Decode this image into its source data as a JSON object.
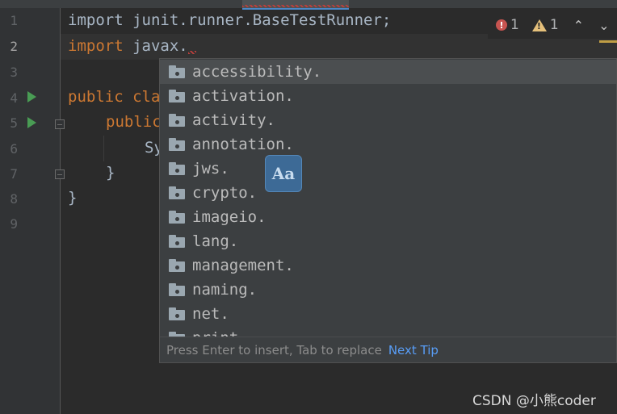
{
  "gutter": {
    "line_numbers": [
      "1",
      "2",
      "3",
      "4",
      "5",
      "6",
      "7",
      "8",
      "9"
    ]
  },
  "code": {
    "line1": "import junit.runner.BaseTestRunner;",
    "line2_kw": "import",
    "line2_rest": " javax.",
    "line4_kw": "public cla",
    "line5_kw": "public",
    "line6": "Sy",
    "line7": "}",
    "line8": "}"
  },
  "inspections": {
    "errors": "1",
    "warnings": "1",
    "up_arrow": "⌃",
    "down_arrow": "⌄"
  },
  "completion": {
    "items": [
      "accessibility.",
      "activation.",
      "activity.",
      "annotation.",
      "jws.",
      "crypto.",
      "imageio.",
      "lang.",
      "management.",
      "naming.",
      "net.",
      "print."
    ],
    "selected_index": 0,
    "footer_hint": "Press Enter to insert, Tab to replace",
    "next_tip": "Next Tip",
    "badge": "Aa"
  },
  "watermark": "CSDN @小熊coder",
  "colors": {
    "background": "#2b2b2b",
    "keyword": "#cc7832",
    "selection": "#4b4e50",
    "link": "#589df6",
    "run": "#499c54"
  }
}
